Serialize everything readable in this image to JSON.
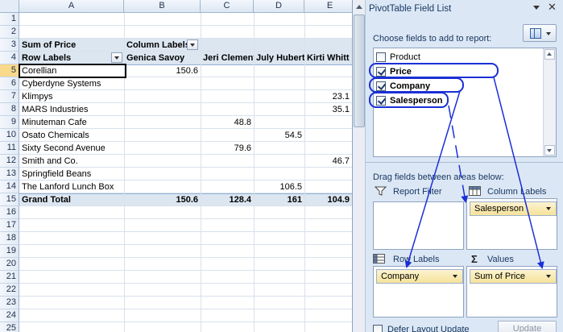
{
  "sheet": {
    "columns": [
      "A",
      "B",
      "C",
      "D",
      "E"
    ],
    "rows": [
      "1",
      "2",
      "3",
      "4",
      "5",
      "6",
      "7",
      "8",
      "9",
      "10",
      "11",
      "12",
      "13",
      "14",
      "15",
      "16",
      "17",
      "18",
      "19",
      "20",
      "21",
      "22",
      "23",
      "24",
      "25"
    ],
    "selected_row": "5",
    "pivot": {
      "value_label": "Sum of Price",
      "column_labels": "Column Labels",
      "row_labels": "Row Labels",
      "salespeople": [
        "Genica Savoy",
        "Jeri Clement",
        "July Hubert",
        "Kirti Whitt"
      ],
      "companies": [
        {
          "name": "Corellian",
          "values": [
            "150.6",
            "",
            "",
            ""
          ]
        },
        {
          "name": "Cyberdyne Systems",
          "values": [
            "",
            "",
            "",
            ""
          ]
        },
        {
          "name": "Klimpys",
          "values": [
            "",
            "",
            "",
            "23.1"
          ]
        },
        {
          "name": "MARS Industries",
          "values": [
            "",
            "",
            "",
            "35.1"
          ]
        },
        {
          "name": "Minuteman Cafe",
          "values": [
            "",
            "48.8",
            "",
            ""
          ]
        },
        {
          "name": "Osato Chemicals",
          "values": [
            "",
            "",
            "54.5",
            ""
          ]
        },
        {
          "name": "Sixty Second Avenue",
          "values": [
            "",
            "79.6",
            "",
            ""
          ]
        },
        {
          "name": "Smith and Co.",
          "values": [
            "",
            "",
            "",
            "46.7"
          ]
        },
        {
          "name": "Springfield Beans",
          "values": [
            "",
            "",
            "",
            ""
          ]
        },
        {
          "name": "The Lanford Lunch Box",
          "values": [
            "",
            "",
            "106.5",
            ""
          ]
        }
      ],
      "grand_total_label": "Grand Total",
      "grand_totals": [
        "150.6",
        "128.4",
        "161",
        "104.9"
      ]
    }
  },
  "pane": {
    "title": "PivotTable Field List",
    "choose_label": "Choose fields to add to report:",
    "fields": [
      {
        "name": "Product",
        "checked": false
      },
      {
        "name": "Price",
        "checked": true
      },
      {
        "name": "Company",
        "checked": true
      },
      {
        "name": "Salesperson",
        "checked": true
      }
    ],
    "drag_label": "Drag fields between areas below:",
    "areas": {
      "report_filter": {
        "label": "Report Filter",
        "items": []
      },
      "column_labels": {
        "label": "Column Labels",
        "items": [
          "Salesperson"
        ]
      },
      "row_labels": {
        "label": "Row Labels",
        "items": [
          "Company"
        ]
      },
      "values": {
        "label": "Values",
        "items": [
          "Sum of Price"
        ]
      }
    },
    "defer_label": "Defer Layout Update",
    "update_label": "Update",
    "icons": [
      "pane-menu-icon",
      "close-icon",
      "field-layout-icon",
      "filter-icon",
      "column-labels-icon",
      "row-labels-icon",
      "sigma-icon"
    ],
    "annotation_color": "#1a2fd6"
  }
}
